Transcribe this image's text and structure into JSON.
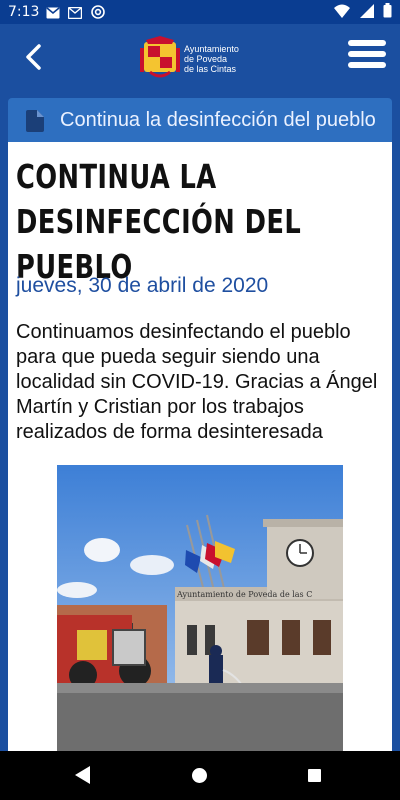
{
  "status_bar": {
    "time": "7:13",
    "left_icons": [
      "gmail-icon",
      "mail-icon",
      "at-sync-icon"
    ],
    "right_icons": [
      "wifi-icon",
      "signal-icon",
      "battery-icon"
    ]
  },
  "app_bar": {
    "logo_line1": "Ayuntamiento",
    "logo_line2": "de Poveda",
    "logo_line3": "de las Cintas",
    "back_icon": "chevron-left-icon",
    "menu_icon": "hamburger-menu-icon",
    "background_color": "#1b4fa0"
  },
  "card": {
    "header_title": "Continua la desinfección del pueblo",
    "header_icon": "document-icon",
    "header_color": "#2e6fc0"
  },
  "article": {
    "title": "CONTINUA LA DESINFECCIÓN DEL PUEBLO",
    "date": "jueves, 30 de abril de 2020",
    "date_color": "#1f4fa0",
    "body": "Continuamos desinfectando el pueblo para que pueda seguir siendo una localidad sin COVID-19. Gracias a Ángel Martín y Cristian por los trabajos realizados de forma desinteresada",
    "photo_sign": "Ayuntamiento de Poveda de las C"
  },
  "nav_bar": {
    "buttons": [
      "back-triangle-icon",
      "home-circle-icon",
      "recents-square-icon"
    ]
  }
}
